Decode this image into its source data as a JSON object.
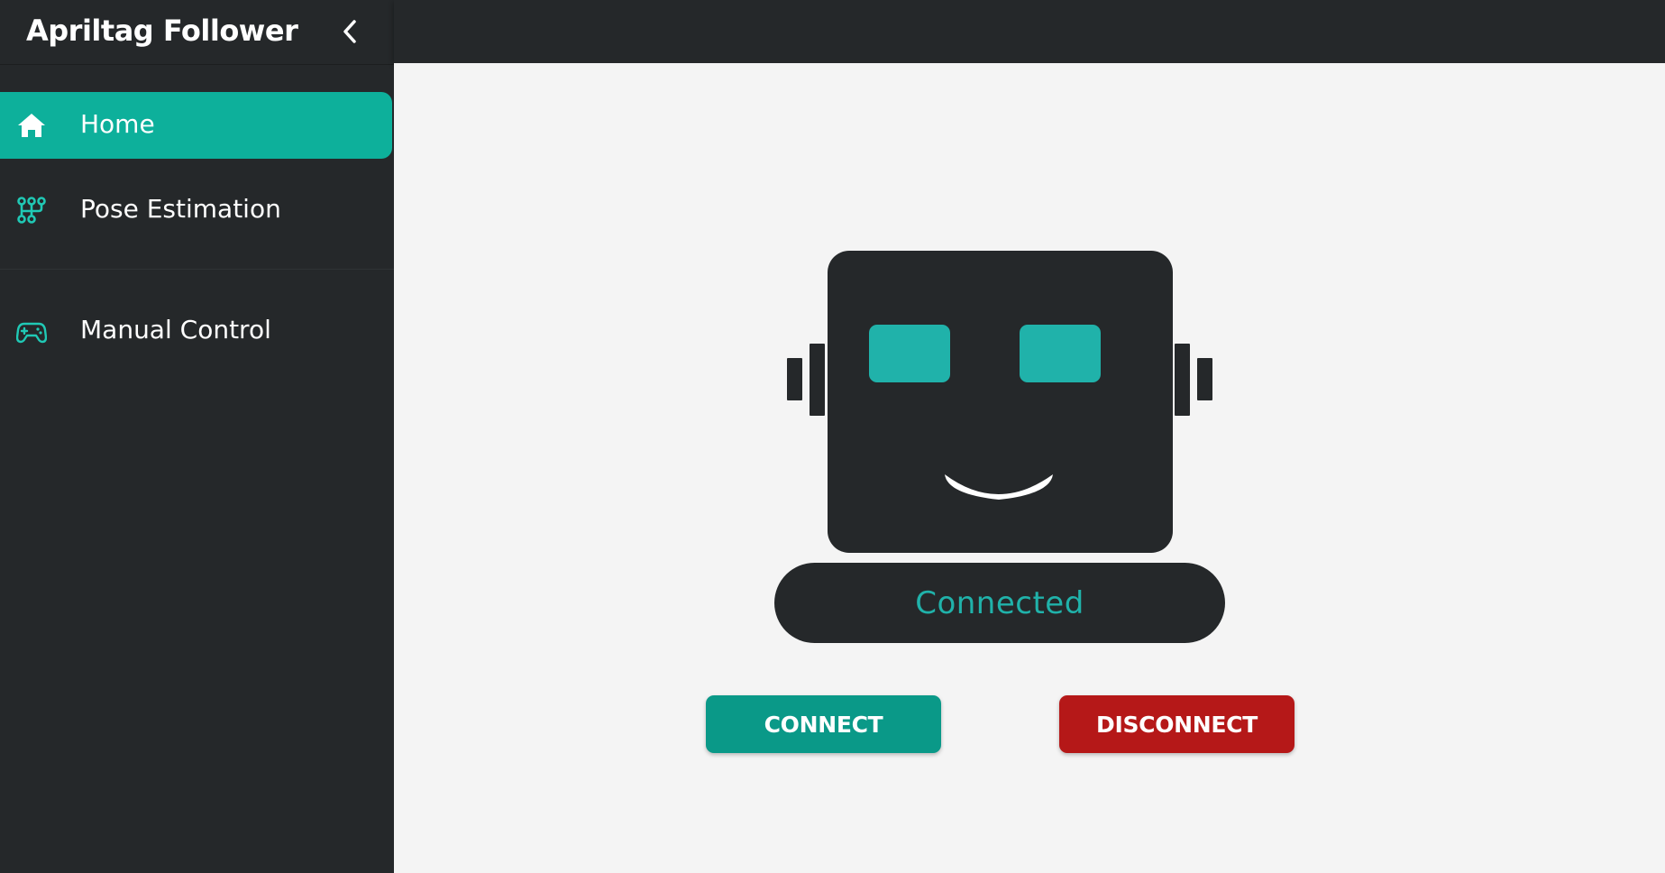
{
  "app": {
    "title": "Apriltag Follower"
  },
  "sidebar": {
    "collapse_icon": "chevron-left-icon",
    "items": [
      {
        "label": "Home",
        "icon": "home-icon",
        "active": true
      },
      {
        "label": "Pose Estimation",
        "icon": "pose-graph-icon",
        "active": false
      },
      {
        "label": "Manual Control",
        "icon": "gamepad-icon",
        "active": false
      }
    ]
  },
  "main": {
    "status_text": "Connected",
    "connect_label": "CONNECT",
    "disconnect_label": "DISCONNECT"
  },
  "colors": {
    "sidebar_bg": "#25282a",
    "accent": "#0db09b",
    "eye": "#20b2aa",
    "status_text": "#20b2aa",
    "connect_bg": "#0a9988",
    "disconnect_bg": "#b51818",
    "main_bg": "#f4f4f4"
  }
}
